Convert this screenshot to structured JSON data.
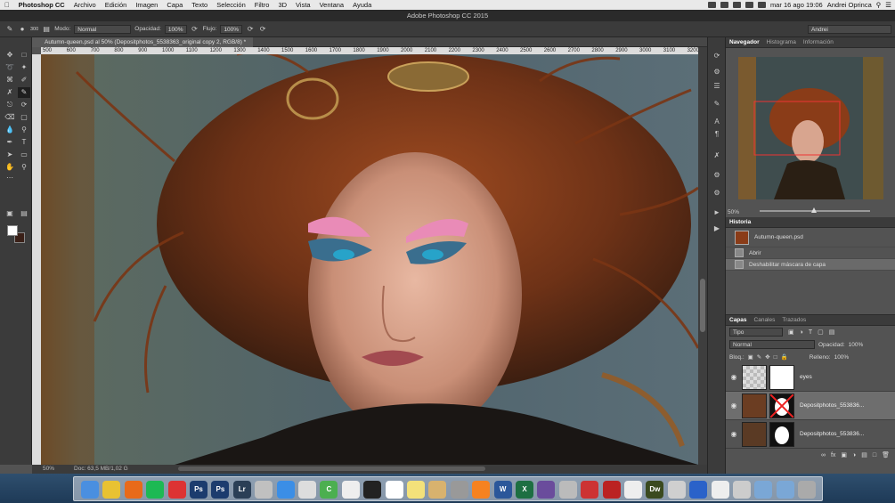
{
  "menubar": {
    "app_name": "Photoshop CC",
    "items": [
      "Archivo",
      "Edición",
      "Imagen",
      "Capa",
      "Texto",
      "Selección",
      "Filtro",
      "3D",
      "Vista",
      "Ventana",
      "Ayuda"
    ],
    "clock": "mar 16 ago  19:06",
    "user": "Andrei Oprinca"
  },
  "titlebar": {
    "title": "Adobe Photoshop CC 2015"
  },
  "options": {
    "mode_label": "Modo:",
    "mode_value": "Normal",
    "opacity_label": "Opacidad:",
    "opacity_value": "100%",
    "flow_label": "Flujo:",
    "flow_value": "100%",
    "brush_size": "300",
    "workspace": "Andrei"
  },
  "document": {
    "tab_title": "Autumn-queen.psd al 50% (Depositphotos_5538363_original copy 2, RGB/8) *",
    "ruler_ticks": [
      "500",
      "600",
      "700",
      "800",
      "900",
      "1000",
      "1100",
      "1200",
      "1300",
      "1400",
      "1500",
      "1600",
      "1700",
      "1800",
      "1900",
      "2000",
      "2100",
      "2200",
      "2300",
      "2400",
      "2500",
      "2600",
      "2700",
      "2800",
      "2900",
      "3000",
      "3100",
      "3200"
    ],
    "zoom": "50%",
    "doc_info": "Doc: 63,5 MB/1,02 G"
  },
  "navigator": {
    "tabs": [
      "Navegador",
      "Histograma",
      "Información"
    ],
    "zoom": "50%"
  },
  "history": {
    "tab": "Historia",
    "snapshot": "Autumn-queen.psd",
    "steps": [
      "Abrir",
      "Deshabilitar máscara de capa"
    ]
  },
  "layers": {
    "tabs": [
      "Capas",
      "Canales",
      "Trazados"
    ],
    "filter_label": "Tipo",
    "blend_mode": "Normal",
    "opacity_label": "Opacidad:",
    "opacity_value": "100%",
    "lock_label": "Bloq.:",
    "fill_label": "Relleno:",
    "fill_value": "100%",
    "rows": [
      {
        "name": "eyes"
      },
      {
        "name": "Depositphotos_553836..."
      },
      {
        "name": "Depositphotos_553836..."
      }
    ]
  },
  "dock": {
    "apps": [
      "finder-icon",
      "chrome-icon",
      "firefox-icon",
      "spotify-icon",
      "calendar-icon",
      "ps-icon",
      "ps-icon",
      "lr-icon",
      "preview-icon",
      "safari-icon",
      "mail-icon",
      "c-icon",
      "grid-icon",
      "activity-icon",
      "cal-icon",
      "notes-icon",
      "files-icon",
      "gear-icon",
      "vlc-icon",
      "word-icon",
      "excel-icon",
      "imovie-icon",
      "calc-icon",
      "mosaic-icon",
      "filezilla-icon",
      "textedit-icon",
      "dreamweaver-icon",
      "mail2-icon",
      "globe-icon",
      "doc-icon",
      "help-icon",
      "folder-icon",
      "folder2-icon",
      "trash-icon"
    ],
    "labels": {
      "ps": "Ps",
      "lr": "Lr",
      "dw": "Dw",
      "w": "W",
      "x": "X",
      "c": "C"
    }
  }
}
